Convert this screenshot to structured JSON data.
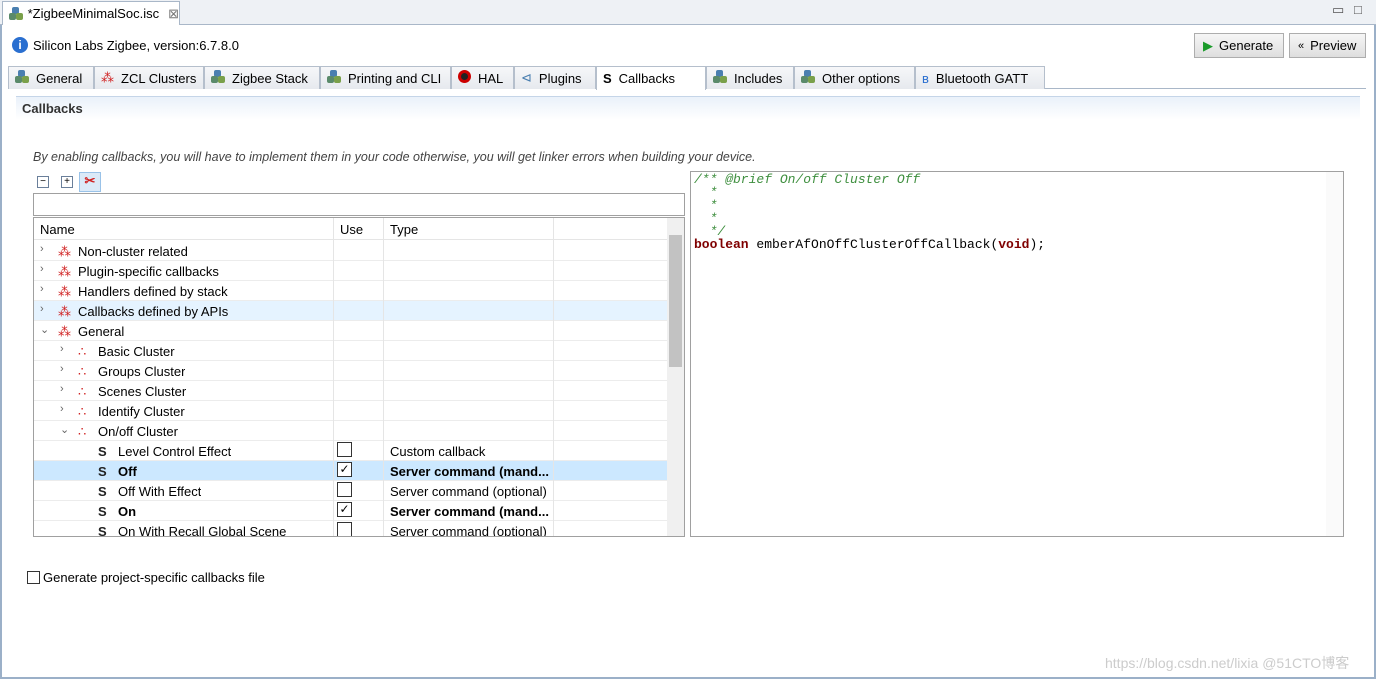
{
  "editor_tab": {
    "title": "*ZigbeeMinimalSoc.isc",
    "close": "⊠"
  },
  "window_controls": {
    "minimize": "▭",
    "maximize": "□"
  },
  "header": {
    "info": "Silicon Labs Zigbee, version:6.7.8.0",
    "generate": "Generate",
    "preview": "Preview"
  },
  "tabs": [
    {
      "label": "General",
      "icon": "cubes-icon"
    },
    {
      "label": "ZCL Clusters",
      "icon": "cluster-icon"
    },
    {
      "label": "Zigbee Stack",
      "icon": "cubes-icon"
    },
    {
      "label": "Printing and CLI",
      "icon": "cubes-icon"
    },
    {
      "label": "HAL",
      "icon": "hal-icon"
    },
    {
      "label": "Plugins",
      "icon": "plugin-icon"
    },
    {
      "label": "Callbacks",
      "icon": "callback-icon",
      "active": true
    },
    {
      "label": "Includes",
      "icon": "cubes-icon"
    },
    {
      "label": "Other options",
      "icon": "cubes-icon"
    },
    {
      "label": "Bluetooth GATT",
      "icon": "bluetooth-icon"
    }
  ],
  "section_title": "Callbacks",
  "description": "By enabling callbacks, you will have to implement them in your code otherwise, you will get linker errors when building your device.",
  "filter": {
    "value": ""
  },
  "columns": [
    "Name",
    "Use",
    "Type"
  ],
  "rows": [
    {
      "name": "Non-cluster related",
      "level": 0,
      "kind": "group",
      "expanded": false,
      "use": null,
      "type": ""
    },
    {
      "name": "Plugin-specific callbacks",
      "level": 0,
      "kind": "group",
      "expanded": false,
      "use": null,
      "type": ""
    },
    {
      "name": "Handlers defined by stack",
      "level": 0,
      "kind": "group",
      "expanded": false,
      "use": null,
      "type": ""
    },
    {
      "name": "Callbacks defined by APIs",
      "level": 0,
      "kind": "group",
      "expanded": false,
      "use": null,
      "type": "",
      "hover": true
    },
    {
      "name": "General",
      "level": 0,
      "kind": "group",
      "expanded": true,
      "use": null,
      "type": ""
    },
    {
      "name": "Basic Cluster",
      "level": 1,
      "kind": "cluster",
      "expanded": false,
      "use": null,
      "type": ""
    },
    {
      "name": "Groups Cluster",
      "level": 1,
      "kind": "cluster",
      "expanded": false,
      "use": null,
      "type": ""
    },
    {
      "name": "Scenes Cluster",
      "level": 1,
      "kind": "cluster",
      "expanded": false,
      "use": null,
      "type": ""
    },
    {
      "name": "Identify Cluster",
      "level": 1,
      "kind": "cluster",
      "expanded": false,
      "use": null,
      "type": ""
    },
    {
      "name": "On/off Cluster",
      "level": 1,
      "kind": "cluster",
      "expanded": true,
      "use": null,
      "type": ""
    },
    {
      "name": "Level Control Effect",
      "level": 2,
      "kind": "callback",
      "use": false,
      "type": "Custom callback"
    },
    {
      "name": "Off",
      "level": 2,
      "kind": "callback",
      "use": true,
      "type": "Server command (mand...",
      "bold": true,
      "selected": true
    },
    {
      "name": "Off With Effect",
      "level": 2,
      "kind": "callback",
      "use": false,
      "type": "Server command (optional)"
    },
    {
      "name": "On",
      "level": 2,
      "kind": "callback",
      "use": true,
      "type": "Server command (mand...",
      "bold": true
    },
    {
      "name": "On With Recall Global Scene",
      "level": 2,
      "kind": "callback",
      "use": false,
      "type": "Server command (optional)"
    }
  ],
  "code": {
    "comment_lines": [
      "/** @brief On/off Cluster Off",
      "  *",
      "  *",
      "  *",
      "  */"
    ],
    "ret": "boolean",
    "fn": " emberAfOnOffClusterOffCallback(",
    "arg": "void",
    "end": ");"
  },
  "generate_file": {
    "label": "Generate project-specific callbacks file",
    "checked": false
  },
  "watermark": "https://blog.csdn.net/lixia @51CTO博客",
  "colors": {
    "accent": "#cce8ff",
    "keyword": "#7f0000",
    "comment": "#3f8f3f"
  }
}
